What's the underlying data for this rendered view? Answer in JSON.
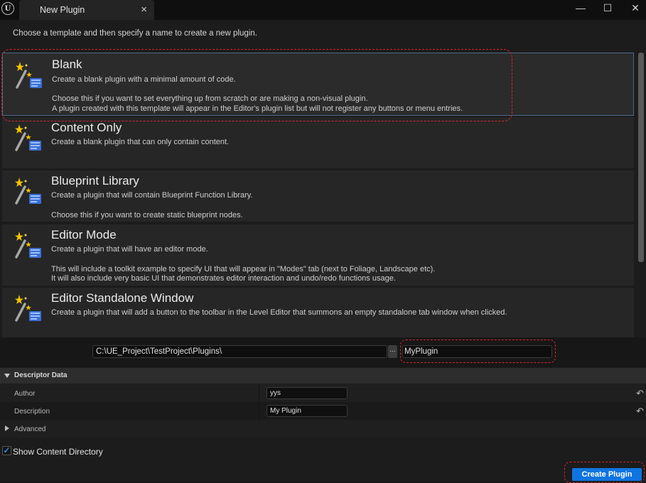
{
  "window": {
    "logo_text": "U",
    "tab_label": "New Plugin",
    "tab_close": "×",
    "minimize": "—",
    "maximize": "☐",
    "close": "✕"
  },
  "instruction": "Choose a template and then specify a name to create a new plugin.",
  "templates": [
    {
      "title": "Blank",
      "lines": [
        "Create a blank plugin with a minimal amount of code.",
        "Choose this if you want to set everything up from scratch or are making a non-visual plugin.",
        "A plugin created with this template will appear in the Editor's plugin list but will not register any buttons or menu entries."
      ],
      "selected": true
    },
    {
      "title": "Content Only",
      "lines": [
        "Create a blank plugin that can only contain content."
      ]
    },
    {
      "title": "Blueprint Library",
      "lines": [
        "Create a plugin that will contain Blueprint Function Library.",
        "Choose this if you want to create static blueprint nodes."
      ]
    },
    {
      "title": "Editor Mode",
      "lines": [
        "Create a plugin that will have an editor mode.",
        "This will include a toolkit example to specify UI that will appear in \"Modes\" tab (next to Foliage, Landscape etc).",
        "It will also include very basic UI that demonstrates editor interaction and undo/redo functions usage."
      ]
    },
    {
      "title": "Editor Standalone Window",
      "lines": [
        "Create a plugin that will add a button to the toolbar in the Level Editor that summons an empty standalone tab window when clicked."
      ]
    }
  ],
  "path": {
    "value": "C:\\UE_Project\\TestProject\\Plugins\\",
    "browse_label": "...",
    "name_value": "MyPlugin"
  },
  "descriptor": {
    "header": "Descriptor Data",
    "author_label": "Author",
    "author_value": "yys",
    "description_label": "Description",
    "description_value": "My Plugin",
    "advanced_label": "Advanced",
    "reset_icon": "↶"
  },
  "show_content_directory": {
    "label": "Show Content Directory",
    "checked": true,
    "check_glyph": "✓"
  },
  "create_button": "Create Plugin",
  "colors": {
    "accent": "#0f74e0",
    "annotation": "#d8252c",
    "selected_border": "#4d6a88"
  }
}
